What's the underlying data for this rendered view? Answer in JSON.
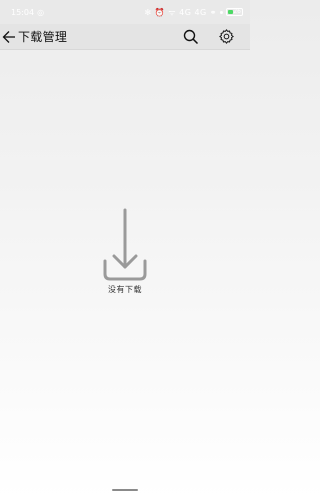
{
  "status_bar": {
    "time": "15:04",
    "icons_left": "◎",
    "icons_right": "✻ ⏰ ᯤ 4G 4G ⚭",
    "battery_text": "26"
  },
  "toolbar": {
    "title": "下载管理"
  },
  "empty_state": {
    "message": "没有下载"
  }
}
